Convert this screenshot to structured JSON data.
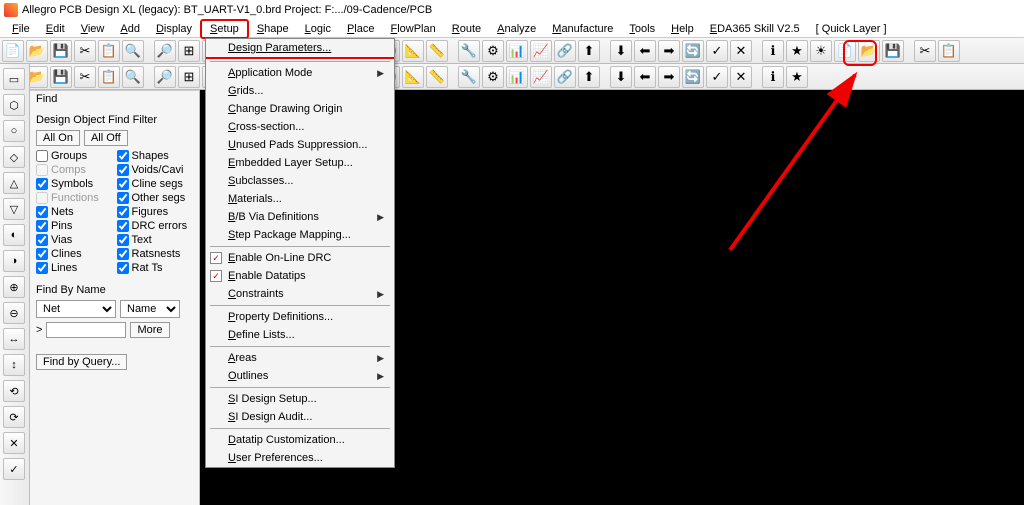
{
  "title": "Allegro PCB Design XL (legacy): BT_UART-V1_0.brd  Project: F:.../09-Cadence/PCB",
  "menu": [
    "File",
    "Edit",
    "View",
    "Add",
    "Display",
    "Setup",
    "Shape",
    "Logic",
    "Place",
    "FlowPlan",
    "Route",
    "Analyze",
    "Manufacture",
    "Tools",
    "Help",
    "EDA365 Skill V2.5",
    "[ Quick Layer ]"
  ],
  "dropdown": {
    "groups": [
      [
        {
          "l": "Design Parameters...",
          "hl": true
        }
      ],
      [
        {
          "l": "Application Mode",
          "sub": true
        },
        {
          "l": "Grids..."
        },
        {
          "l": "Change Drawing Origin"
        },
        {
          "l": "Cross-section..."
        },
        {
          "l": "Unused Pads Suppression..."
        },
        {
          "l": "Embedded Layer Setup..."
        },
        {
          "l": "Subclasses..."
        },
        {
          "l": "Materials..."
        },
        {
          "l": "B/B Via Definitions",
          "sub": true
        },
        {
          "l": "Step Package Mapping..."
        }
      ],
      [
        {
          "l": "Enable On-Line DRC",
          "chk": true
        },
        {
          "l": "Enable Datatips",
          "chk": true
        },
        {
          "l": "Constraints",
          "sub": true
        }
      ],
      [
        {
          "l": "Property Definitions..."
        },
        {
          "l": "Define Lists..."
        }
      ],
      [
        {
          "l": "Areas",
          "sub": true
        },
        {
          "l": "Outlines",
          "sub": true
        }
      ],
      [
        {
          "l": "SI Design Setup..."
        },
        {
          "l": "SI Design Audit..."
        }
      ],
      [
        {
          "l": "Datatip Customization..."
        },
        {
          "l": "User Preferences..."
        }
      ]
    ]
  },
  "find": {
    "panel_title": "Find",
    "subtitle": "Design Object Find Filter",
    "all_on": "All On",
    "all_off": "All Off",
    "left": [
      {
        "l": "Groups",
        "c": false
      },
      {
        "l": "Comps",
        "c": false,
        "dis": true
      },
      {
        "l": "Symbols",
        "c": true
      },
      {
        "l": "Functions",
        "c": false,
        "dis": true
      },
      {
        "l": "Nets",
        "c": true
      },
      {
        "l": "Pins",
        "c": true
      },
      {
        "l": "Vias",
        "c": true
      },
      {
        "l": "Clines",
        "c": true
      },
      {
        "l": "Lines",
        "c": true
      }
    ],
    "right": [
      {
        "l": "Shapes",
        "c": true
      },
      {
        "l": "Voids/Cavi",
        "c": true
      },
      {
        "l": "Cline segs",
        "c": true
      },
      {
        "l": "Other segs",
        "c": true
      },
      {
        "l": "Figures",
        "c": true
      },
      {
        "l": "DRC errors",
        "c": true
      },
      {
        "l": "Text",
        "c": true
      },
      {
        "l": "Ratsnests",
        "c": true
      },
      {
        "l": "Rat Ts",
        "c": true
      }
    ],
    "find_by_name": "Find By Name",
    "net": "Net",
    "name": "Name",
    "more": "More",
    "find_by_query": "Find by Query...",
    "arrow": ">"
  }
}
